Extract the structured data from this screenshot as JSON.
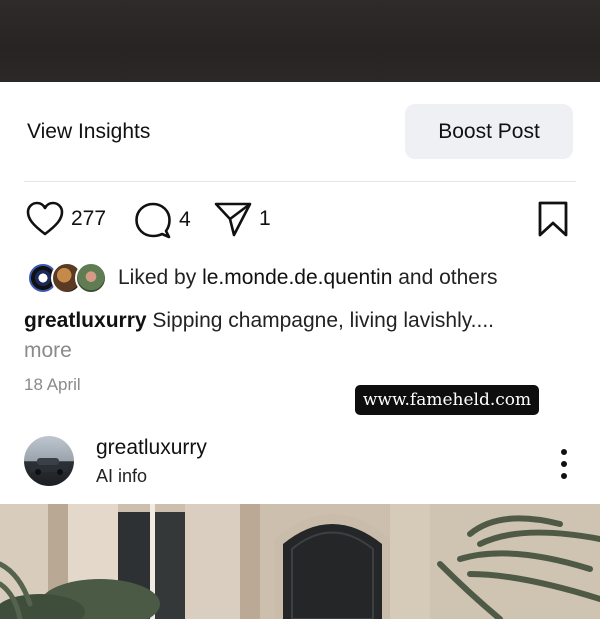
{
  "insights": {
    "view_label": "View Insights",
    "boost_label": "Boost Post"
  },
  "actions": {
    "likes": "277",
    "comments": "4",
    "shares": "1"
  },
  "liked_by": {
    "prefix": "Liked by ",
    "user": "le.monde.de.quentin",
    "suffix": " and others"
  },
  "caption": {
    "username": "greatluxurry",
    "text": " Sipping champagne, living lavishly....",
    "more": "more"
  },
  "date": "18 April",
  "watermark": "www.fameheld.com",
  "next_post": {
    "username": "greatluxurry",
    "subtitle": "AI info"
  },
  "icons": [
    "heart-icon",
    "comment-icon",
    "share-icon",
    "bookmark-icon",
    "more-options-icon"
  ]
}
